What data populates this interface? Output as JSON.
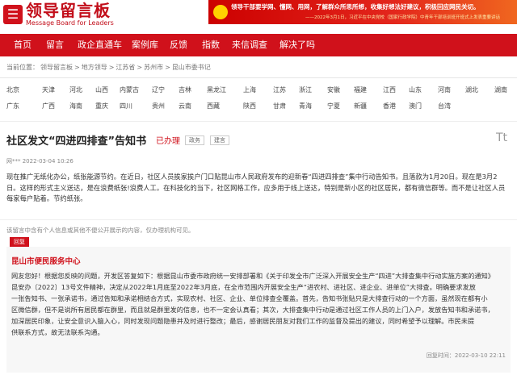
{
  "header": {
    "logo_cn": "领导留言板",
    "logo_en": "Message Board for Leaders",
    "banner_line1": "领导干部要学网、懂网、用网，了解群众所思所想，收集好想法好建议，积极回应网民关切。",
    "banner_line2": "——2022年3月1日，习近平在中央党校（国家行政学院）中青年干部培训班开班式上发表重要讲话"
  },
  "nav": {
    "items": [
      "首页",
      "留言",
      "政企直通车",
      "案例库",
      "反馈",
      "指数",
      "来信调查",
      "解决了吗"
    ]
  },
  "breadcrumb": {
    "items": [
      "当前位置：",
      "领导留言板",
      ">",
      "地方领导",
      ">",
      "江苏省",
      ">",
      "苏州市",
      ">",
      "昆山市委书记"
    ]
  },
  "regions": {
    "row1": [
      "北京",
      "天津",
      "河北",
      "山西",
      "内蒙古",
      "辽宁",
      "吉林",
      "黑龙江",
      "上海",
      "江苏",
      "浙江",
      "安徽",
      "福建",
      "江西",
      "山东",
      "河南",
      "湖北",
      "湖南"
    ],
    "row2": [
      "广东",
      "广西",
      "海南",
      "重庆",
      "四川",
      "贵州",
      "云南",
      "西藏",
      "陕西",
      "甘肃",
      "青海",
      "宁夏",
      "新疆",
      "香港",
      "澳门",
      "台湾"
    ]
  },
  "message": {
    "title": "社区发文“四进四排查”告知书",
    "status": "已办理",
    "tags": [
      "政务",
      "建言"
    ],
    "font_icon": "Tt",
    "author_line": "网*** 2022-03-04 10:26",
    "body_lines": [
      "现在推广无纸化办公，纸张能源节约。在近日，社区人员挨家挨户门口贴昆山市人民政府发布的迎新春“四进四排查”集中行动告知书。且落款为1月20日。现在是3月2",
      "日。这样的形式主义送达，是在浪费纸张!浪费人工。在科技化的当下，社区网格工作，应多用于线上送达，特别是新小区的社区居民，都有微信群等。而不是让社区人员",
      "每家每户贴着。节约纸张。"
    ]
  },
  "notice": "该留言中含有个人信息或其他不便公开展示的内容，仅办理机构可见。",
  "reply": {
    "badge": "回复",
    "org": "昆山市便民服务中心",
    "lines": [
      "网友您好！根据您反映的问题，开发区答复如下：根据昆山市委市政府统一安排部署和《关于印发全市广泛深入开展安全生产“四进”大排查集中行动实施方案的通知》",
      "昆安办〔2022〕13号文件精神，决定从2022年1月底至2022年3月底，在全市范围内开展安全生产“进农村、进社区、进企业、进单位”大排查。明确要求发放",
      "一张告知书、一张承诺书，通过告知和承诺相结合方式，实现农村、社区、企业、单位排查全覆盖。首先，告知书张贴只是大排查行动的一个方面，虽然现在都有小",
      "区微信群，但不是说所有居民都在群里，而且就是群里发的信息，也不一定会认真看；其次，大排查集中行动是通过社区工作人员的上门入户，发放告知书和承诺书，",
      "加深居民印象，让安全意识入脑入心，同时发现问题隐患并及时进行整改；最后，感谢居民朋友对我们工作的监督及提出的建议，同时希望予以理解。市民未提",
      "供联系方式，故无法联系沟通。"
    ],
    "time": "回复时间：2022-03-10 22:11"
  }
}
